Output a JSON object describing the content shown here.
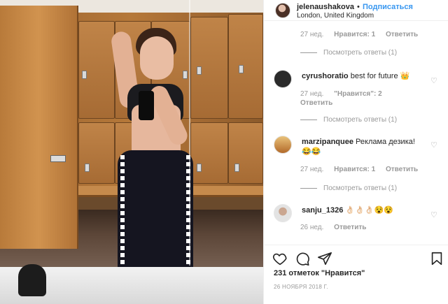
{
  "post": {
    "username": "jelenaushakova",
    "separator": "•",
    "follow_label": "Подписаться",
    "location": "London, United Kingdom"
  },
  "comments": [
    {
      "meta": {
        "time": "27 нед.",
        "likes": "Нравится: 1",
        "reply": "Ответить"
      },
      "view_replies": "Посмотреть ответы (1)"
    },
    {
      "username": "cyrushoratio",
      "text": "best for future 👑",
      "meta": {
        "time": "27 нед.",
        "likes": "\"Нравится\": 2",
        "reply": "Ответить"
      },
      "view_replies": "Посмотреть ответы (1)",
      "avatar_color": "#2b2b2b"
    },
    {
      "username": "marzipanquee",
      "text": "Реклама дезика! 😂😂",
      "meta": {
        "time": "27 нед.",
        "likes": "Нравится: 1",
        "reply": "Ответить"
      },
      "view_replies": "Посмотреть ответы (1)",
      "avatar_color": "#c98b3a"
    },
    {
      "username": "sanju_1326",
      "text": "👌🏻👌🏻👌🏻😵😵",
      "meta": {
        "time": "26 нед.",
        "reply": "Ответить"
      },
      "avatar_color": "#d8d8d8"
    }
  ],
  "footer": {
    "likes": "231 отметок \"Нравится\"",
    "date": "26 НОЯБРЯ 2018 Г."
  },
  "icons": {
    "like": "heart-icon",
    "comment": "comment-icon",
    "share": "share-icon",
    "save": "bookmark-icon"
  },
  "colors": {
    "accent": "#3897f0",
    "muted": "#999999",
    "text": "#262626"
  }
}
